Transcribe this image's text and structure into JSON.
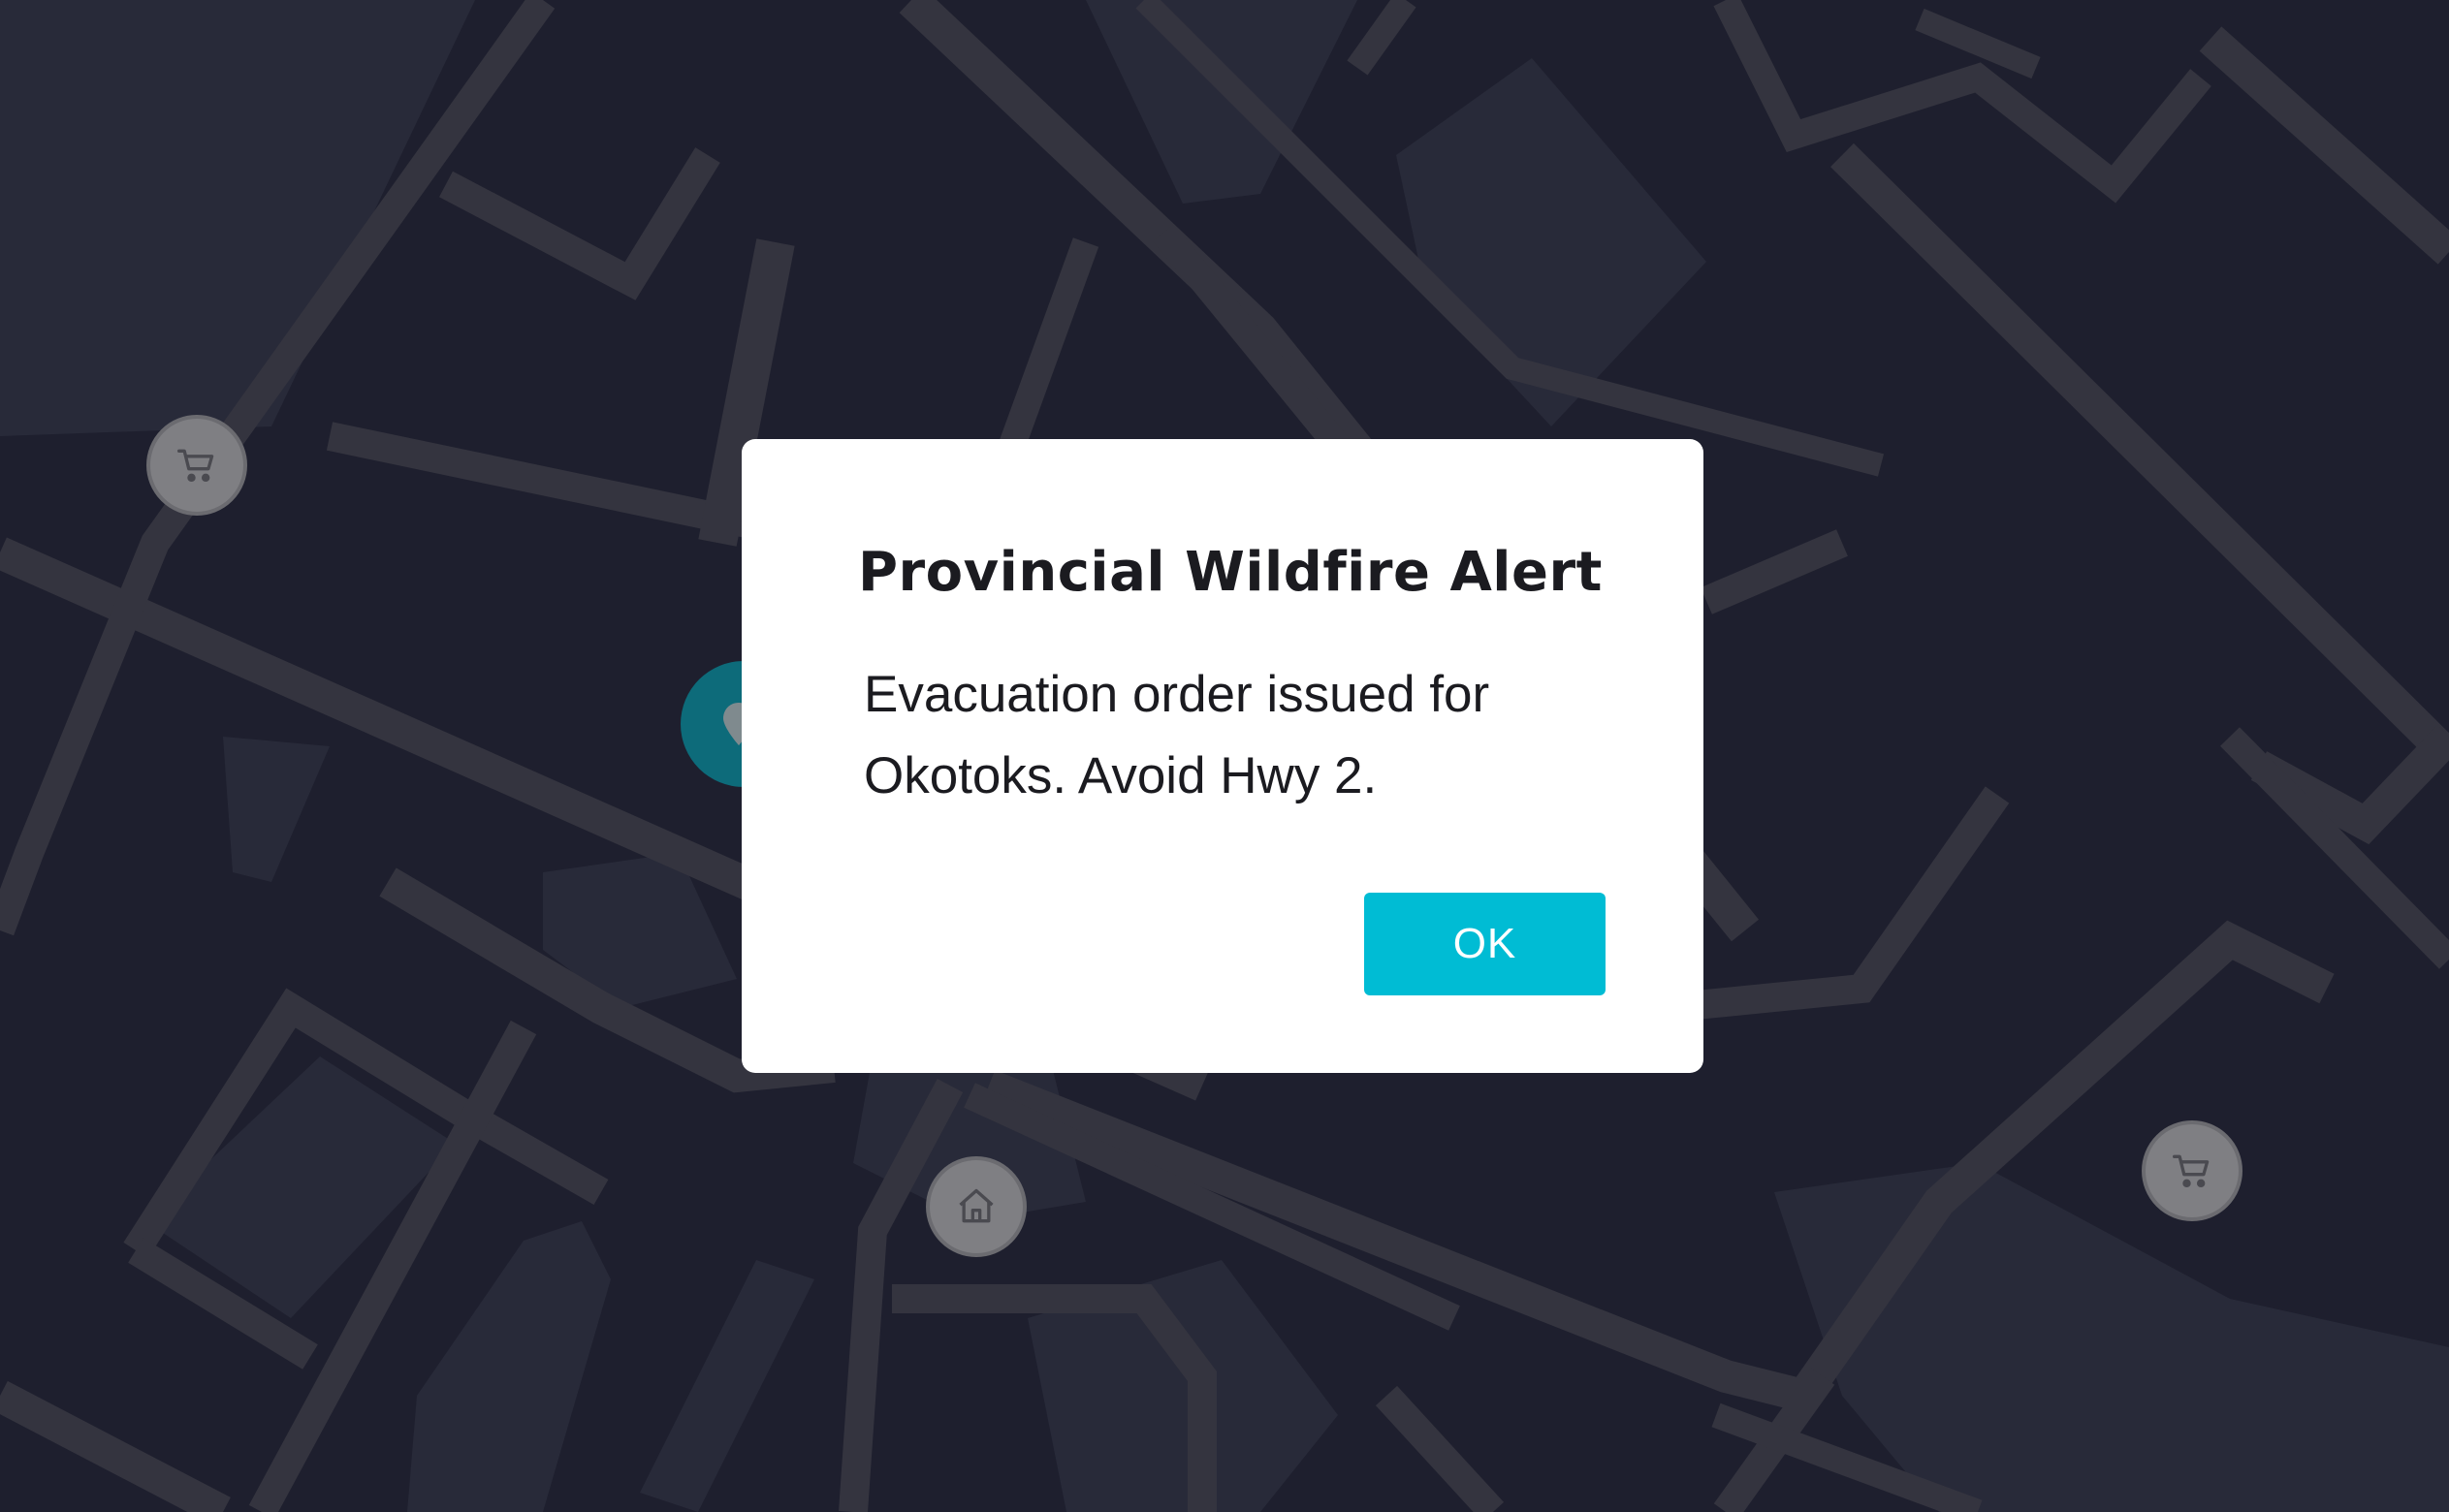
{
  "dialog": {
    "title": "Provincial Wildfire Alert",
    "message": "Evacuation order issued for Okotoks. Avoid Hwy 2.",
    "ok_label": "OK"
  },
  "map": {
    "markers": [
      {
        "icon": "shopping-cart-icon"
      },
      {
        "icon": "location-pin-icon"
      },
      {
        "icon": "home-icon"
      },
      {
        "icon": "shopping-cart-icon"
      }
    ]
  },
  "colors": {
    "map_background": "#1e1f2e",
    "road": "#34343f",
    "block": "#282a39",
    "accent": "#00bcd4",
    "marker": "#7f7f83",
    "selected_marker": "#0d6b7a"
  }
}
